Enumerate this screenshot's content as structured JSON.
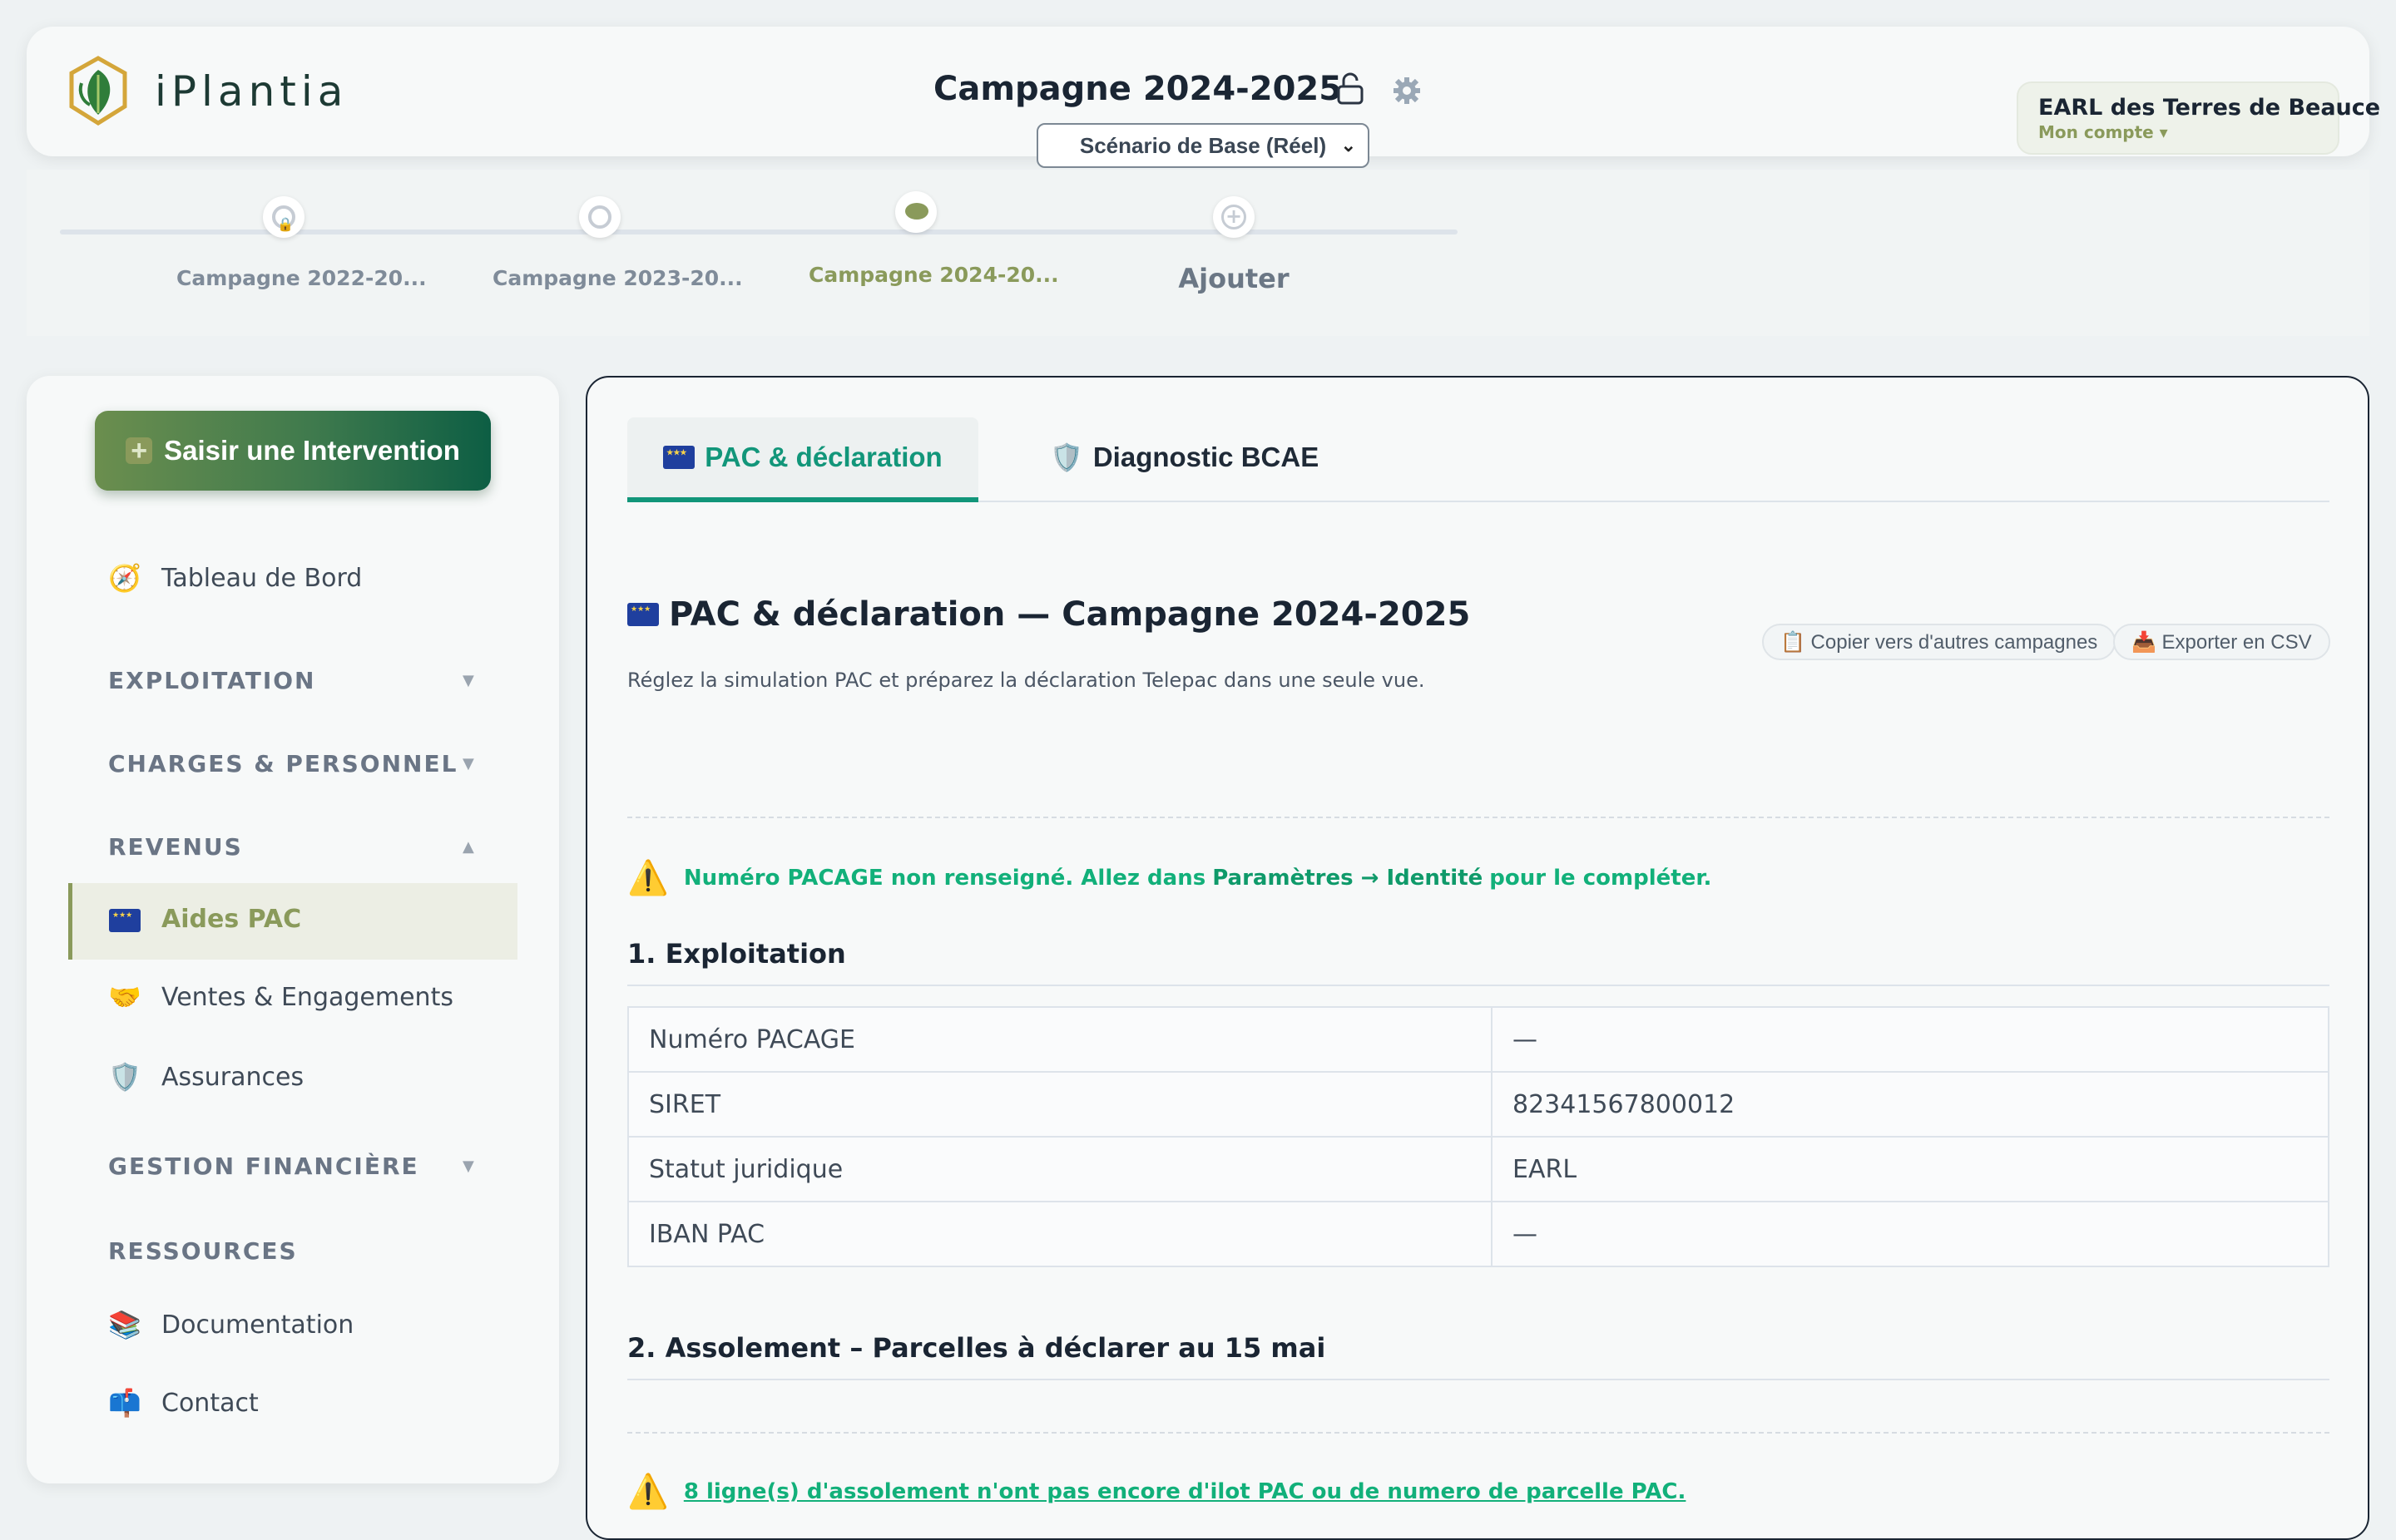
{
  "app": {
    "name": "iPlantia"
  },
  "header": {
    "campaign_title": "Campagne 2024-2025",
    "scenario": "Scénario de Base (Réel)",
    "account": {
      "name": "EARL des Terres de Beauce",
      "sub": "Mon compte ▾"
    }
  },
  "timeline": {
    "items": [
      {
        "label": "Campagne 2022-20...",
        "state": "locked"
      },
      {
        "label": "Campagne 2023-20...",
        "state": "past"
      },
      {
        "label": "Campagne 2024-20...",
        "state": "active"
      },
      {
        "label": "Ajouter",
        "state": "add"
      }
    ]
  },
  "sidebar": {
    "cta": "Saisir une Intervention",
    "dashboard": "Tableau de Bord",
    "sections": {
      "exploitation": "EXPLOITATION",
      "charges": "CHARGES & PERSONNEL",
      "revenus": "REVENUS",
      "gestion": "GESTION FINANCIÈRE",
      "ressources": "RESSOURCES"
    },
    "items": {
      "aides_pac": "Aides PAC",
      "ventes": "Ventes & Engagements",
      "assurances": "Assurances",
      "documentation": "Documentation",
      "contact": "Contact"
    },
    "icons": {
      "dashboard": "compass-icon",
      "aides_pac": "eu-flag-icon",
      "ventes": "handshake-icon",
      "assurances": "shield-icon",
      "documentation": "books-icon",
      "contact": "mailbox-icon"
    }
  },
  "main": {
    "tabs": [
      {
        "label": "PAC & déclaration",
        "active": true
      },
      {
        "label": "Diagnostic BCAE",
        "active": false
      }
    ],
    "title": "PAC & déclaration — Campagne 2024-2025",
    "subtitle": "Réglez la simulation PAC et préparez la déclaration Telepac dans une seule vue.",
    "actions": {
      "copy": "📋 Copier vers d'autres campagnes",
      "export": "📥 Exporter en CSV"
    },
    "warning_pacage": {
      "before": "Numéro PACAGE non renseigné. Allez dans ",
      "bold": "Paramètres → Identité",
      "after": " pour le compléter."
    },
    "section1": {
      "title": "1. Exploitation",
      "rows": [
        {
          "key": "Numéro PACAGE",
          "value": "—"
        },
        {
          "key": "SIRET",
          "value": "82341567800012"
        },
        {
          "key": "Statut juridique",
          "value": "EARL"
        },
        {
          "key": "IBAN PAC",
          "value": "—"
        }
      ]
    },
    "section2": {
      "title": "2. Assolement – Parcelles à déclarer au 15 mai"
    },
    "warning_assolement": "8 ligne(s) d'assolement n'ont pas encore d'ilot PAC ou de numero de parcelle PAC."
  },
  "colors": {
    "accent_green": "#12967a",
    "olive": "#8a9a5b",
    "warning_text": "#12b07a"
  }
}
